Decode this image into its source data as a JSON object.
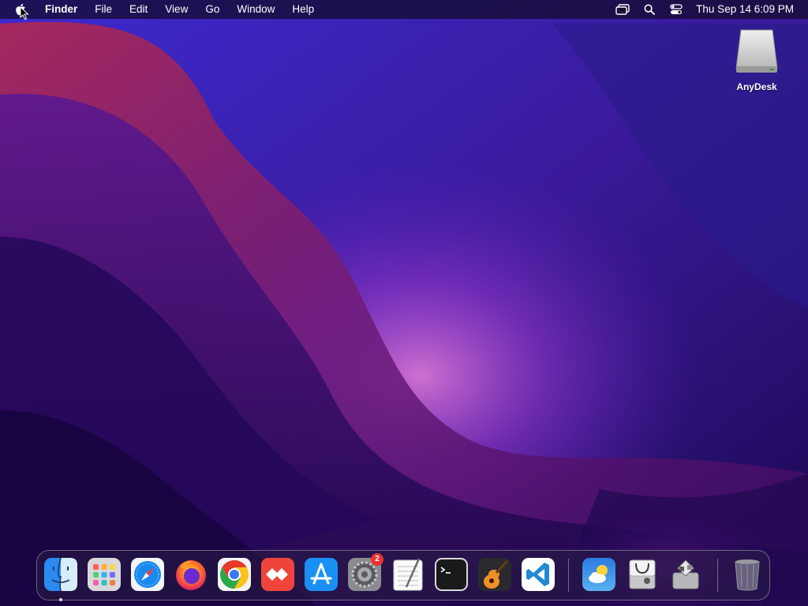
{
  "menubar": {
    "apple_icon": "apple-icon",
    "app_name": "Finder",
    "menus": [
      "File",
      "Edit",
      "View",
      "Go",
      "Window",
      "Help"
    ],
    "status_icons": [
      "screen-mirroring-icon",
      "spotlight-search-icon",
      "control-center-icon"
    ],
    "clock": "Thu Sep 14  6:09 PM"
  },
  "desktop": {
    "icons": [
      {
        "label": "AnyDesk",
        "icon": "external-drive-icon"
      }
    ]
  },
  "dock": {
    "apps": [
      {
        "name": "Finder",
        "icon": "finder-icon",
        "running": true
      },
      {
        "name": "Launchpad",
        "icon": "launchpad-icon"
      },
      {
        "name": "Safari",
        "icon": "safari-icon"
      },
      {
        "name": "Firefox",
        "icon": "firefox-icon"
      },
      {
        "name": "Google Chrome",
        "icon": "chrome-icon"
      },
      {
        "name": "AnyDesk",
        "icon": "anydesk-icon"
      },
      {
        "name": "App Store",
        "icon": "app-store-icon"
      },
      {
        "name": "System Settings",
        "icon": "system-settings-icon",
        "badge": "2"
      },
      {
        "name": "TextEdit",
        "icon": "textedit-icon"
      },
      {
        "name": "Terminal",
        "icon": "terminal-icon"
      },
      {
        "name": "GarageBand",
        "icon": "garageband-icon"
      },
      {
        "name": "Visual Studio Code",
        "icon": "vscode-icon"
      },
      {
        "name": "Weather",
        "icon": "weather-icon"
      },
      {
        "name": "Disk Utility",
        "icon": "disk-utility-icon"
      },
      {
        "name": "Boot Camp Assistant",
        "icon": "boot-camp-icon"
      },
      {
        "name": "Trash",
        "icon": "trash-icon"
      }
    ]
  },
  "colors": {
    "wallpaper_base": "#2a0a6a",
    "wallpaper_glow": "#c04ad8",
    "badge": "#e8332f",
    "menubar_bg": "#120a28"
  }
}
